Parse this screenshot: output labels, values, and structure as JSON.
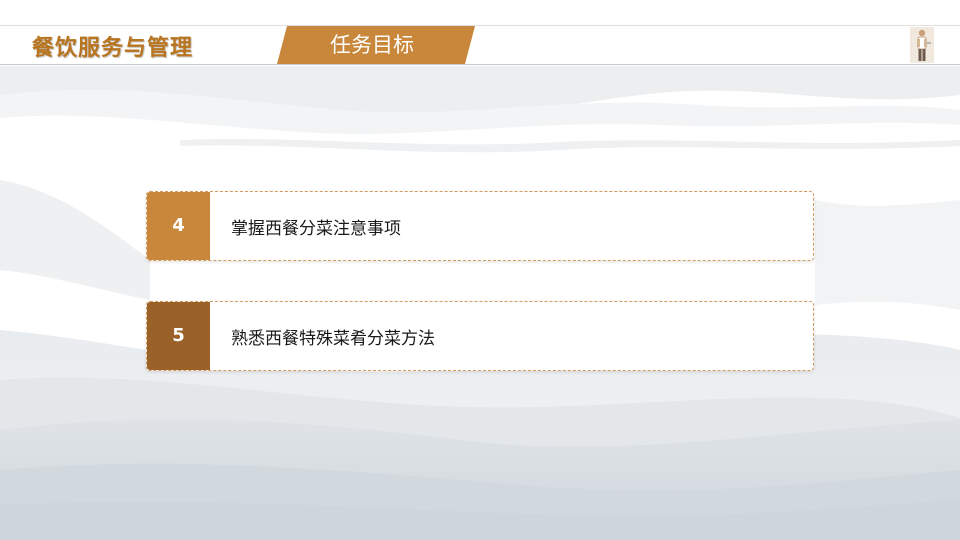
{
  "header": {
    "course_title": "餐饮服务与管理",
    "section_label": "任务目标"
  },
  "objectives": [
    {
      "number": "4",
      "text": "掌握西餐分菜注意事项",
      "color": "#c8873a"
    },
    {
      "number": "5",
      "text": "熟悉西餐特殊菜肴分菜方法",
      "color": "#9a6228"
    }
  ],
  "colors": {
    "accent": "#c8873a",
    "accent_dark": "#9a6228",
    "title": "#b8741e"
  },
  "icons": {
    "corner": "waiter-figure-icon"
  }
}
